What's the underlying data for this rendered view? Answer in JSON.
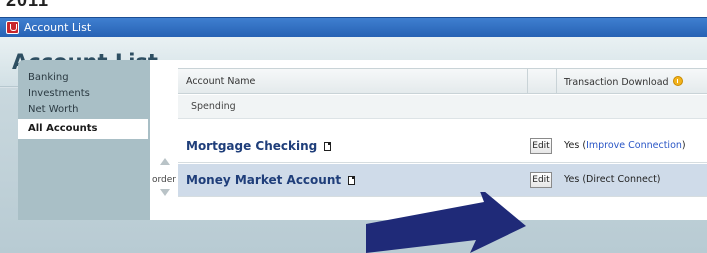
{
  "top_fragment": "2011",
  "window": {
    "title": "Account List"
  },
  "header": {
    "title": "Account List"
  },
  "sidebar": {
    "items": [
      {
        "label": "Banking",
        "active": false
      },
      {
        "label": "Investments",
        "active": false
      },
      {
        "label": "Net Worth",
        "active": false
      },
      {
        "label": "All Accounts",
        "active": true
      }
    ]
  },
  "table": {
    "columns": [
      {
        "label": "Account Name"
      },
      {
        "label": ""
      },
      {
        "label": "Transaction Download"
      }
    ],
    "group": {
      "label": "Spending"
    },
    "rows": [
      {
        "name": "Mortgage Checking",
        "edit_label": "Edit",
        "download_prefix": "Yes (",
        "download_link": "Improve Connection",
        "download_suffix": ")"
      },
      {
        "name": "Money Market Account",
        "edit_label": "Edit",
        "download_prefix": "Yes (Direct Connect)",
        "download_link": "",
        "download_suffix": ""
      }
    ],
    "order_label": "order"
  },
  "icons": {
    "app": "quicken-app-icon",
    "account": "document-icon",
    "warning": "warning-icon",
    "move_up": "arrow-up-icon",
    "move_down": "arrow-down-icon",
    "annotation": "pointer-arrow-icon"
  },
  "colors": {
    "titlebar": "#2762b4",
    "selected_row": "#cfdbe9",
    "link": "#2a56c6",
    "annotation_arrow": "#1f2a78"
  }
}
